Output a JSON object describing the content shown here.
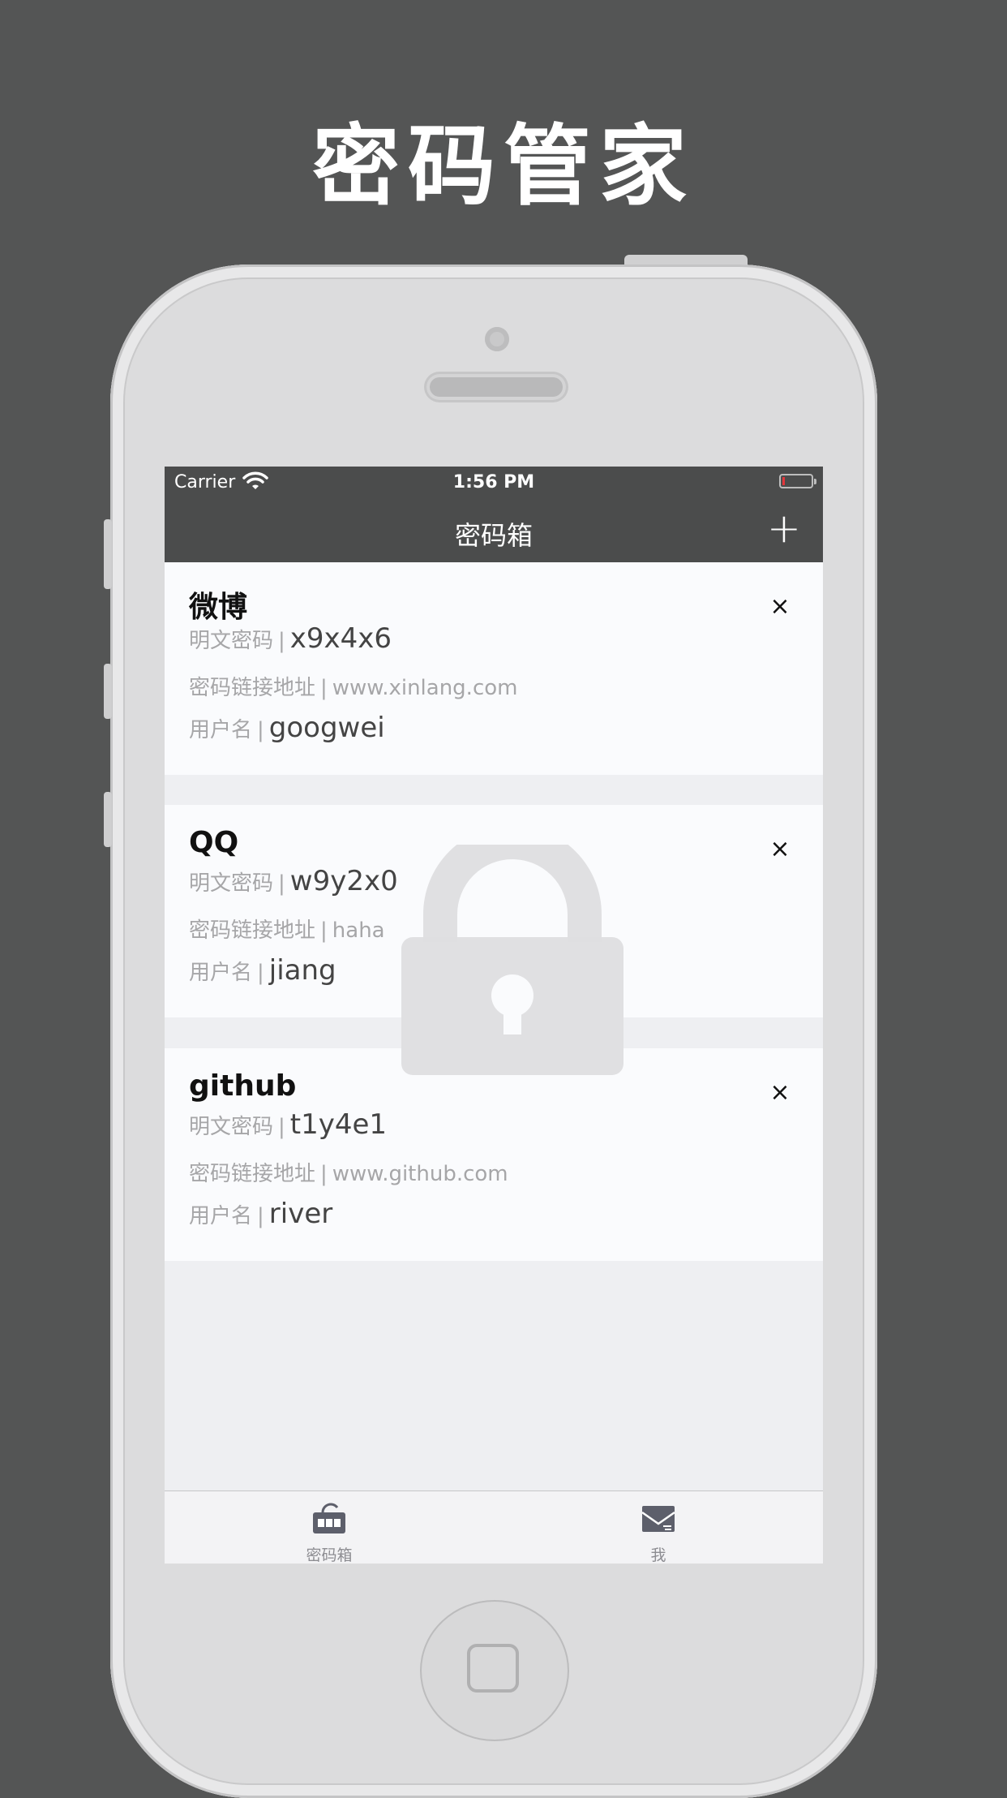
{
  "page_title": "密码管家",
  "status_bar": {
    "carrier": "Carrier",
    "time": "1:56 PM"
  },
  "nav": {
    "title": "密码箱",
    "add_label": "+"
  },
  "labels": {
    "password": "明文密码",
    "link": "密码链接地址",
    "username": "用户名",
    "separator": "|",
    "delete": "×"
  },
  "entries": [
    {
      "name": "微博",
      "password": "x9x4x6",
      "url": "www.xinlang.com",
      "username": "googwei"
    },
    {
      "name": "QQ",
      "password": "w9y2x0",
      "url": "haha",
      "username": "jiang"
    },
    {
      "name": "github",
      "password": "t1y4e1",
      "url": "www.github.com",
      "username": "river"
    }
  ],
  "tabs": [
    {
      "label": "密码箱",
      "icon": "lock-box-icon"
    },
    {
      "label": "我",
      "icon": "profile-envelope-icon"
    }
  ],
  "colors": {
    "background": "#545555",
    "nav_bar": "#4b4c4c",
    "card": "#fafbfd",
    "screen": "#eeeff2"
  }
}
